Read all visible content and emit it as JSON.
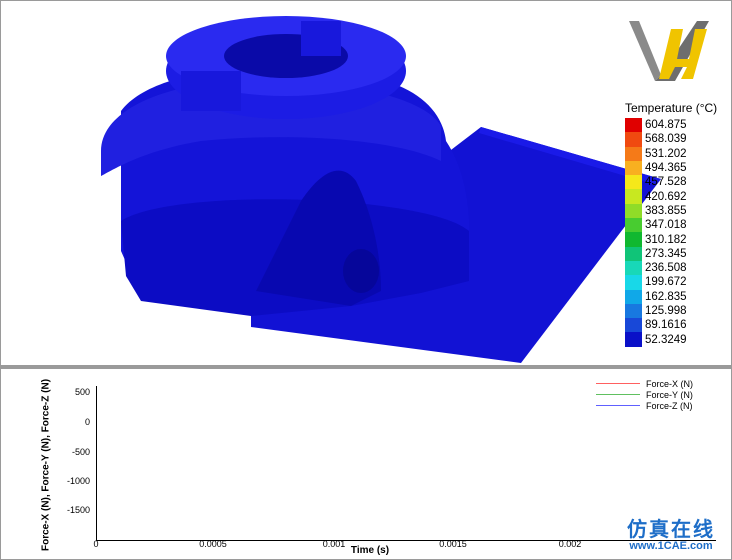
{
  "viewport": {
    "legend": {
      "title": "Temperature (°C)",
      "entries": [
        {
          "value": "604.875",
          "color": "#e00000"
        },
        {
          "value": "568.039",
          "color": "#f04a10"
        },
        {
          "value": "531.202",
          "color": "#f57a18"
        },
        {
          "value": "494.365",
          "color": "#f8b020"
        },
        {
          "value": "457.528",
          "color": "#f5e81a"
        },
        {
          "value": "420.692",
          "color": "#c8e820"
        },
        {
          "value": "383.855",
          "color": "#90dc28"
        },
        {
          "value": "347.018",
          "color": "#48cc30"
        },
        {
          "value": "310.182",
          "color": "#10b830"
        },
        {
          "value": "273.345",
          "color": "#10c478"
        },
        {
          "value": "236.508",
          "color": "#18d8b8"
        },
        {
          "value": "199.672",
          "color": "#18d8e8"
        },
        {
          "value": "162.835",
          "color": "#10a8e8"
        },
        {
          "value": "125.998",
          "color": "#1878e0"
        },
        {
          "value": "89.1616",
          "color": "#1848d8"
        },
        {
          "value": "52.3249",
          "color": "#0a10c8"
        }
      ]
    },
    "model_color": "#1212d4",
    "logo_icon": "vh-logo-icon"
  },
  "plot": {
    "y_axis_label": "Force-X (N), Force-Y (N), Force-Z (N)",
    "y_ticks": [
      "500",
      "0",
      "-500",
      "-1000",
      "-1500"
    ],
    "x_axis_label": "Time (s)",
    "x_ticks": [
      "0",
      "0.0005",
      "0.001",
      "0.0015",
      "0.002"
    ],
    "legend": [
      {
        "label": "Force-X (N)",
        "color": "#ff6060"
      },
      {
        "label": "Force-Y (N)",
        "color": "#60c060"
      },
      {
        "label": "Force-Z (N)",
        "color": "#6060ff"
      }
    ]
  },
  "watermark": {
    "text_cn": "仿真在线",
    "url": "www.1CAE.com"
  }
}
